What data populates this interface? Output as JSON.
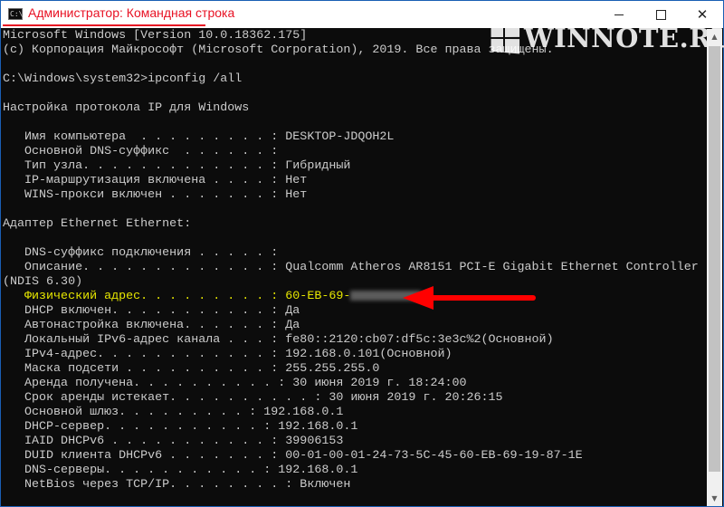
{
  "window": {
    "title": "Администратор: Командная строка",
    "icon": "C:\\",
    "controls": {
      "minimize": "",
      "maximize": "",
      "close": "✕"
    }
  },
  "watermark": {
    "text": "WINNOTE.RU"
  },
  "colors": {
    "console_bg": "#0c0c0c",
    "console_fg": "#cccccc",
    "highlight": "#e6e600",
    "accent_red": "#e81123"
  },
  "console": {
    "lines": [
      "Microsoft Windows [Version 10.0.18362.175]",
      "(c) Корпорация Майкрософт (Microsoft Corporation), 2019. Все права защищены.",
      "",
      "C:\\Windows\\system32>ipconfig /all",
      "",
      "Настройка протокола IP для Windows",
      "",
      "   Имя компьютера  . . . . . . . . . : DESKTOP-JDQOH2L",
      "   Основной DNS-суффикс  . . . . . . :",
      "   Тип узла. . . . . . . . . . . . . : Гибридный",
      "   IP-маршрутизация включена . . . . : Нет",
      "   WINS-прокси включен . . . . . . . : Нет",
      "",
      "Адаптер Ethernet Ethernet:",
      "",
      "   DNS-суффикс подключения . . . . . :",
      "   Описание. . . . . . . . . . . . . : Qualcomm Atheros AR8151 PCI-E Gigabit Ethernet Controller",
      "(NDIS 6.30)",
      "__MAC__",
      "   DHCP включен. . . . . . . . . . . : Да",
      "   Автонастройка включена. . . . . . : Да",
      "   Локальный IPv6-адрес канала . . . : fe80::2120:cb07:df5c:3e3c%2(Основной)",
      "   IPv4-адрес. . . . . . . . . . . . : 192.168.0.101(Основной)",
      "   Маска подсети . . . . . . . . . . : 255.255.255.0",
      "   Аренда получена. . . . . . . . . . : 30 июня 2019 г. 18:24:00",
      "   Срок аренды истекает. . . . . . . . . . : 30 июня 2019 г. 20:26:15",
      "   Основной шлюз. . . . . . . . . : 192.168.0.1",
      "   DHCP-сервер. . . . . . . . . . . : 192.168.0.1",
      "   IAID DHCPv6 . . . . . . . . . . . : 39906153",
      "   DUID клиента DHCPv6 . . . . . . . : 00-01-00-01-24-73-5C-45-60-EB-69-19-87-1E",
      "   DNS-серверы. . . . . . . . . . . : 192.168.0.1",
      "   NetBios через TCP/IP. . . . . . . . : Включен"
    ],
    "mac_line": {
      "label": "   Физический адрес. . . . . . . . . : ",
      "value_visible": "60-EB-69-"
    }
  },
  "annotation": {
    "icon": "red-arrow-icon"
  }
}
